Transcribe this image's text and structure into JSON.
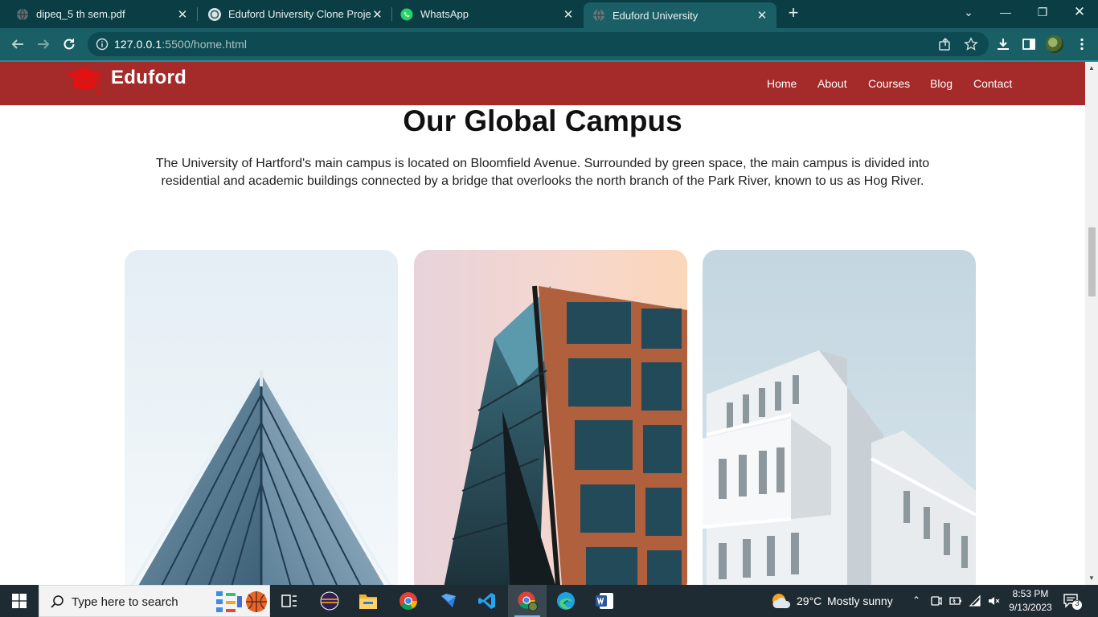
{
  "browser": {
    "tabs": [
      {
        "title": "dipeq_5 th sem.pdf",
        "icon": "globe-icon"
      },
      {
        "title": "Eduford University Clone Project",
        "icon": "chatgpt-icon"
      },
      {
        "title": "WhatsApp",
        "icon": "whatsapp-icon"
      },
      {
        "title": "Eduford University",
        "icon": "globe-icon",
        "active": true
      }
    ],
    "new_tab": "+",
    "url_host": "127.0.0.1",
    "url_path": ":5500/home.html"
  },
  "site": {
    "brand": "Eduford",
    "nav": [
      "Home",
      "About",
      "Courses",
      "Blog",
      "Contact"
    ],
    "section_title": "Our Global Campus",
    "section_text": "The University of Hartford's main campus is located on Bloomfield Avenue. Surrounded by green space, the main campus is divided into residential and academic buildings connected by a bridge that overlooks the north branch of the Park River, known to us as Hog River.",
    "accent_color": "#a52a2a"
  },
  "taskbar": {
    "search_placeholder": "Type here to search",
    "weather_temp": "29°C",
    "weather_desc": "Mostly sunny",
    "time": "8:53 PM",
    "date": "9/13/2023",
    "notification_count": "3"
  },
  "colors": {
    "chrome_dark": "#0a3d44",
    "chrome_toolbar": "#1a5f66",
    "taskbar": "#1f2b33"
  }
}
